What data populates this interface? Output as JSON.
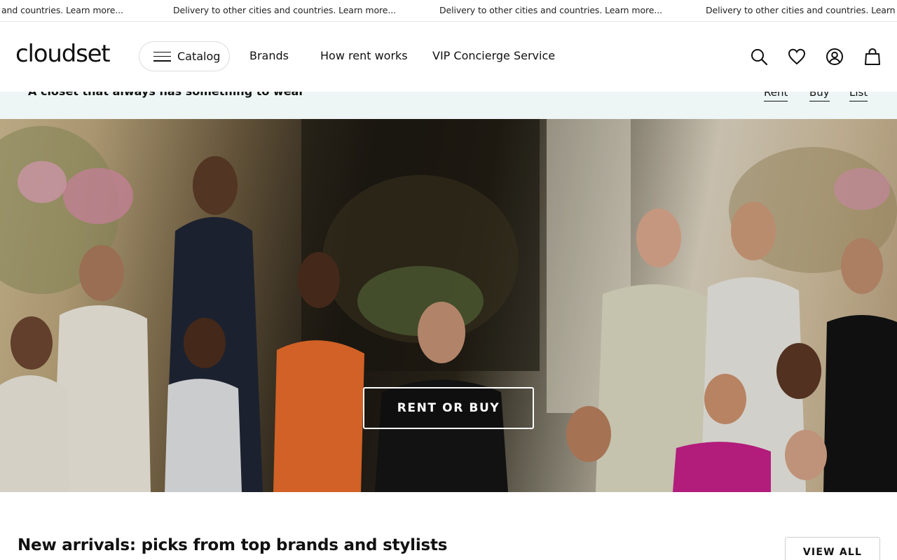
{
  "ticker": {
    "items": [
      "and countries. Learn more...",
      "Delivery to other cities and countries. Learn more...",
      "Delivery to other cities and countries. Learn more...",
      "Delivery to other cities and countries. Learn mo"
    ]
  },
  "header": {
    "logo": "cloudset",
    "catalog_label": "Catalog",
    "nav": [
      "Brands",
      "How rent works",
      "VIP Concierge Service"
    ],
    "icons": [
      "search-icon",
      "heart-icon",
      "account-icon",
      "bag-icon"
    ]
  },
  "subbar": {
    "tagline": "A closet that always has something to wear",
    "links": [
      "Rent",
      "Buy",
      "List"
    ]
  },
  "hero": {
    "cta_label": "RENT OR BUY"
  },
  "arrivals": {
    "title": "New arrivals: picks from top brands and stylists",
    "view_all_label": "VIEW ALL"
  },
  "colors": {
    "subbar_bg": "#eef5f5",
    "text": "#111111"
  }
}
